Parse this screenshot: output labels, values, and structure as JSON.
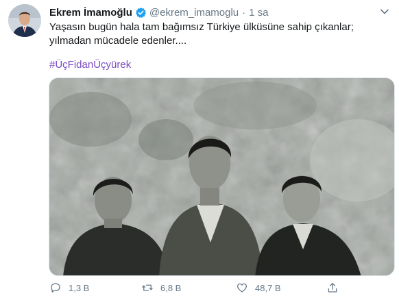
{
  "author": {
    "display_name": "Ekrem İmamoğlu",
    "handle": "@ekrem_imamoglu",
    "separator": "·",
    "time": "1 sa"
  },
  "tweet": {
    "text": "Yaşasın bugün hala tam bağımsız Türkiye ülküsüne sahip çıkanlar; yılmadan mücadele edenler....",
    "hashtag": "#ÜçFidanÜçyürek"
  },
  "actions": {
    "reply_count": "1,3 B",
    "retweet_count": "6,8 B",
    "like_count": "48,7 B"
  },
  "colors": {
    "hashtag": "#794bc4",
    "verified": "#1da1f2",
    "muted": "#657786"
  },
  "icons": [
    "verified-badge-icon",
    "chevron-down-icon",
    "reply-icon",
    "retweet-icon",
    "like-icon",
    "share-icon"
  ]
}
